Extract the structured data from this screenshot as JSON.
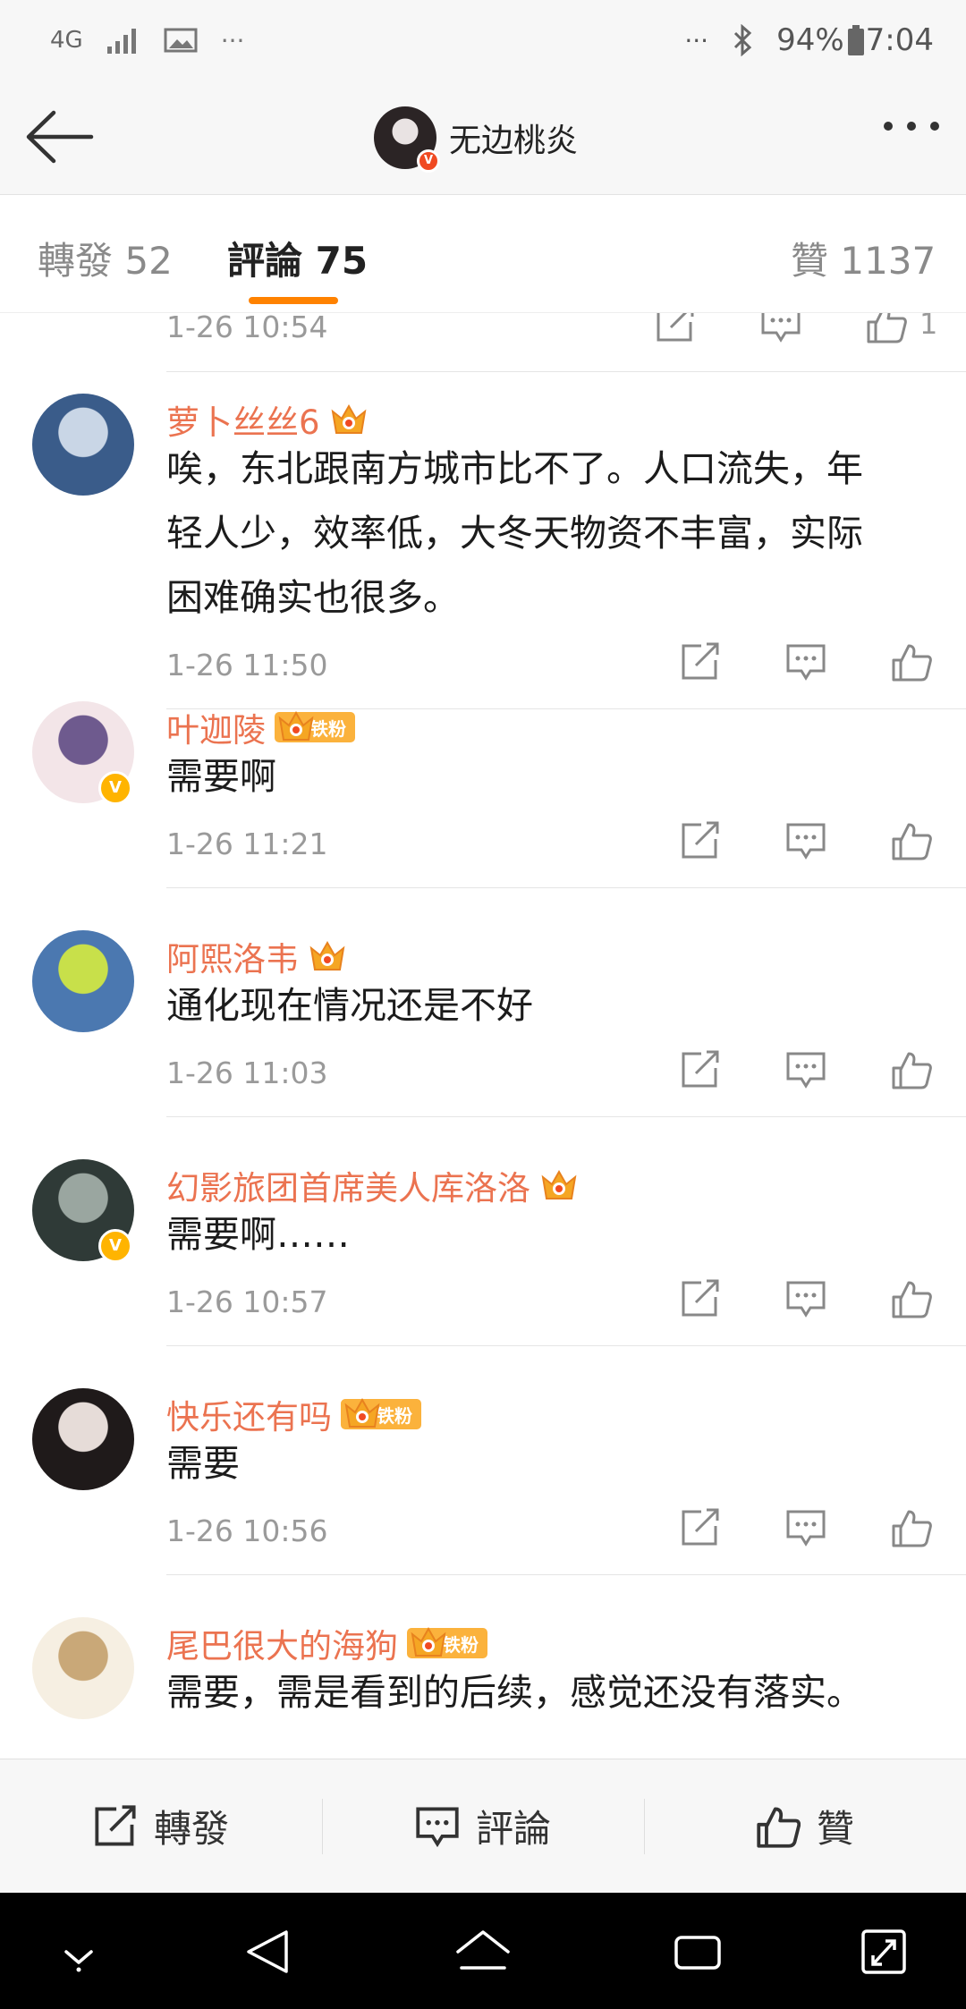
{
  "status_bar": {
    "network": "4G",
    "battery": "94%",
    "time": "7:04",
    "dots": "···"
  },
  "nav": {
    "title": "无边桃炎",
    "verified_badge": "V"
  },
  "tabs": [
    {
      "label": "轉發 52"
    },
    {
      "label": "評論 75"
    },
    {
      "label": "贊 1137"
    }
  ],
  "partial_row": {
    "time": "1-26 10:54",
    "likes": "1"
  },
  "comments": [
    {
      "username": "萝卜丝丝6",
      "fan_badge": "",
      "text_lines": [
        "唉，东北跟南方城市比不了。人口流失，年",
        "轻人少，效率低，大冬天物资不丰富，实际",
        "困难确实也很多。"
      ],
      "time": "1-26 11:50",
      "verified": false,
      "avatar_colors": [
        "#3a5c8a",
        "#c9d6e6"
      ]
    },
    {
      "username": "叶迦陵",
      "fan_badge": "铁粉",
      "text_lines": [
        "需要啊"
      ],
      "time": "1-26 11:21",
      "verified": true,
      "avatar_colors": [
        "#f3e5e8",
        "#6e5a8e"
      ]
    },
    {
      "username": "阿熙洛韦",
      "fan_badge": "",
      "text_lines": [
        "通化现在情况还是不好"
      ],
      "time": "1-26 11:03",
      "verified": false,
      "avatar_colors": [
        "#4b78b0",
        "#c8e04a"
      ]
    },
    {
      "username": "幻影旅团首席美人库洛洛",
      "fan_badge": "",
      "text_lines": [
        "需要啊……"
      ],
      "time": "1-26 10:57",
      "verified": true,
      "avatar_colors": [
        "#2f3a37",
        "#9aa6a0"
      ]
    },
    {
      "username": "快乐还有吗",
      "fan_badge": "铁粉",
      "text_lines": [
        "需要"
      ],
      "time": "1-26 10:56",
      "verified": false,
      "avatar_colors": [
        "#1f1a1a",
        "#e6dcd8"
      ]
    },
    {
      "username": "尾巴很大的海狗",
      "fan_badge": "铁粉",
      "text_lines": [
        "需要，需是看到的后续，感觉还没有落实。"
      ],
      "time": "",
      "verified": false,
      "avatar_colors": [
        "#f6efe2",
        "#c9a878"
      ]
    }
  ],
  "toolbar": {
    "repost": "轉發",
    "comment": "評論",
    "like": "贊"
  },
  "colors": {
    "accent": "#ff8200",
    "username": "#eb7350",
    "fan_badge": "#fbb23c"
  }
}
